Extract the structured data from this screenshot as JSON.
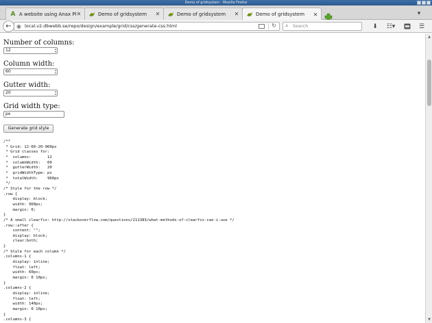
{
  "window": {
    "title": "Demo of gridsystem - Mozilla Firefox"
  },
  "tabs": [
    {
      "title": "A website using Anax Pla...",
      "icon": "anax-icon",
      "active": false
    },
    {
      "title": "Demo of gridsystem",
      "icon": "bird-icon",
      "active": false
    },
    {
      "title": "Demo of gridsystem",
      "icon": "bird-icon",
      "active": false
    },
    {
      "title": "Demo of gridsystem",
      "icon": "bird-icon",
      "active": true
    }
  ],
  "nav": {
    "url": "local.v2.dbwebb.se/repo/design/example/grid/css/generate-css.html",
    "search_placeholder": "Search"
  },
  "form": {
    "columns_label": "Number of columns:",
    "columns_value": "12",
    "column_width_label": "Column width:",
    "column_width_value": "60",
    "gutter_label": "Gutter width:",
    "gutter_value": "20",
    "grid_type_label": "Grid width type:",
    "grid_type_value": "px",
    "generate_label": "Generate grid style"
  },
  "output": {
    "code": "/**\n * Grid: 12-60-20-960px\n * Grid classes for:\n *  columns:       12\n *  columnWidth:   60\n *  gutterWidth:   20\n *  gridWidthType: px\n *  totalWidth:    960px\n */\n/* Style for the row */\n.row {\n    display: block;\n    width: 960px;\n    margin: 0;\n}\n/* A small clearfix: http://stackoverflow.com/questions/211383/what-methods-of-clearfix-can-i-use */\n.row::after {\n    content: \"\";\n    display: block;\n    clear:both;\n}\n/* Style for each column */\n.columns-1 {\n    display: inline;\n    float: left;\n    width: 60px;\n    margin: 0 10px;\n}\n.columns-2 {\n    display: inline;\n    float: left;\n    width: 140px;\n    margin: 0 10px;\n}\n.columns-3 {"
  }
}
